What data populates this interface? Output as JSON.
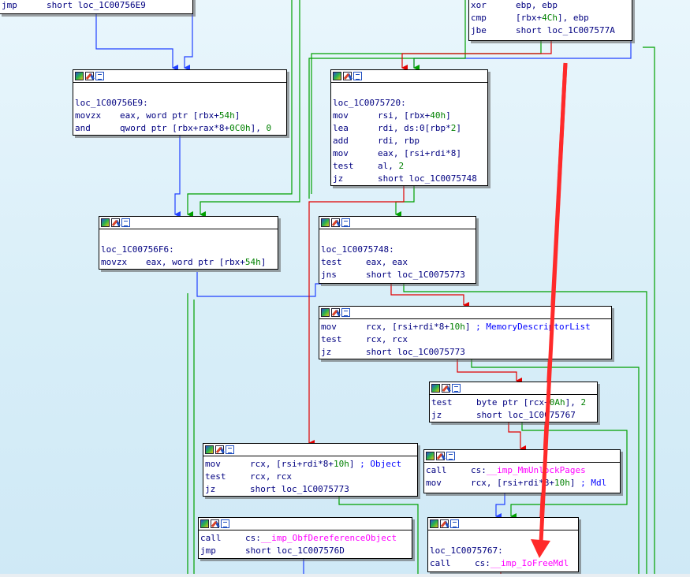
{
  "colors": {
    "edge_true": "#00a000",
    "edge_false": "#e00000",
    "edge_uncond": "#2040ff",
    "annotation": "#ff2a2a",
    "label": "#000080",
    "number": "#008000",
    "import": "#ff00ff",
    "comment": "#0000ff"
  },
  "nodes": {
    "top_left": {
      "lines": [
        {
          "mn": "jmp",
          "op": "short loc_1C00756E9"
        }
      ]
    },
    "top_right": {
      "lines": [
        {
          "mn": "xor",
          "op": "ebp, ebp"
        },
        {
          "mn": "cmp",
          "op_pre": "[rbx+",
          "op_num": "4Ch",
          "op_post": "], ebp"
        },
        {
          "mn": "jbe",
          "op": "short loc_1C007577A"
        }
      ]
    },
    "n_56e9": {
      "label": "loc_1C00756E9:",
      "lines": [
        {
          "mn": "movzx",
          "op_pre": "eax, word ptr [rbx+",
          "op_num": "54h",
          "op_post": "]"
        },
        {
          "mn": "and",
          "op_pre": "qword ptr [rbx+rax*8+",
          "op_num": "0C0h",
          "op_post": "], ",
          "op_num2": "0"
        }
      ]
    },
    "n_5720": {
      "label": "loc_1C0075720:",
      "lines": [
        {
          "mn": "mov",
          "op_pre": "rsi, [rbx+",
          "op_num": "40h",
          "op_post": "]"
        },
        {
          "mn": "lea",
          "op_pre": "rdi, ds:0[rbp*",
          "op_num": "2",
          "op_post": "]"
        },
        {
          "mn": "add",
          "op": "rdi, rbp"
        },
        {
          "mn": "mov",
          "op": "eax, [rsi+rdi*8]"
        },
        {
          "mn": "test",
          "op_pre": "al, ",
          "op_num": "2",
          "op_post": ""
        },
        {
          "mn": "jz",
          "op": "short loc_1C0075748"
        }
      ]
    },
    "n_56f6": {
      "label": "loc_1C00756F6:",
      "lines": [
        {
          "mn": "movzx",
          "op_pre": "eax, word ptr [rbx+",
          "op_num": "54h",
          "op_post": "]"
        }
      ]
    },
    "n_5748": {
      "label": "loc_1C0075748:",
      "lines": [
        {
          "mn": "test",
          "op": "eax, eax"
        },
        {
          "mn": "jns",
          "op": "short loc_1C0075773"
        }
      ]
    },
    "n_mdl": {
      "lines": [
        {
          "mn": "mov",
          "op_pre": "rcx, [rsi+rdi*8+",
          "op_num": "10h",
          "op_post": "] ",
          "comment": "; MemoryDescriptorList"
        },
        {
          "mn": "test",
          "op": "rcx, rcx"
        },
        {
          "mn": "jz",
          "op": "short loc_1C0075773"
        }
      ]
    },
    "n_test_byte": {
      "lines": [
        {
          "mn": "test",
          "op_pre": "byte ptr [rcx+",
          "op_num": "0Ah",
          "op_post": "], ",
          "op_num2": "2"
        },
        {
          "mn": "jz",
          "op": "short loc_1C0075767"
        }
      ]
    },
    "n_object": {
      "lines": [
        {
          "mn": "mov",
          "op_pre": "rcx, [rsi+rdi*8+",
          "op_num": "10h",
          "op_post": "] ",
          "comment": "; Object"
        },
        {
          "mn": "test",
          "op": "rcx, rcx"
        },
        {
          "mn": "jz",
          "op": "short loc_1C0075773"
        }
      ]
    },
    "n_unlock": {
      "lines": [
        {
          "mn": "call",
          "op_pre": "cs:",
          "imp": "__imp_MmUnlockPages"
        },
        {
          "mn": "mov",
          "op_pre": "rcx, [rsi+rdi*8+",
          "op_num": "10h",
          "op_post": "] ",
          "comment": "; Mdl"
        }
      ]
    },
    "n_deref": {
      "lines": [
        {
          "mn": "call",
          "op_pre": "cs:",
          "imp": "__imp_ObfDereferenceObject"
        },
        {
          "mn": "jmp",
          "op": "short loc_1C007576D"
        }
      ]
    },
    "n_5767": {
      "label": "loc_1C0075767:",
      "lines": [
        {
          "mn": "call",
          "op_pre": "cs:",
          "imp": "__imp_IoFreeMdl"
        }
      ]
    }
  }
}
